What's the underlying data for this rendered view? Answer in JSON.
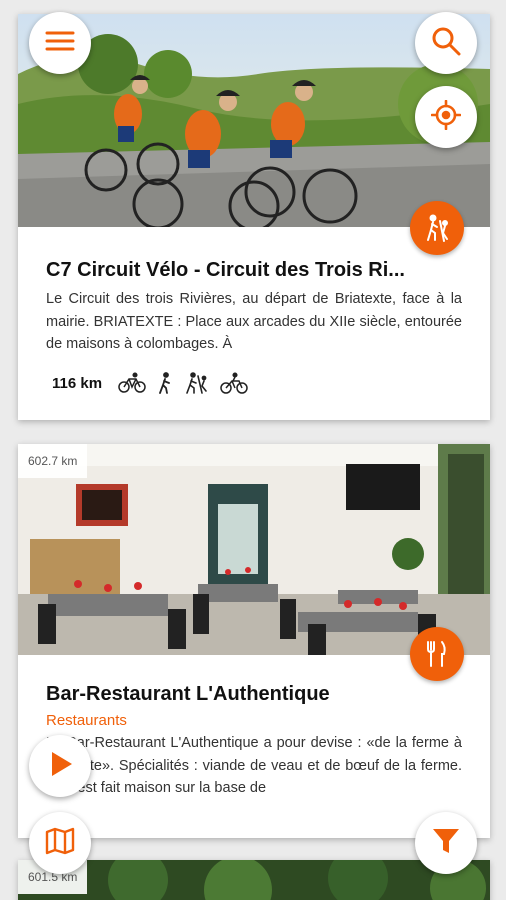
{
  "cards": [
    {
      "distance_tag": "",
      "title": "C7 Circuit Vélo - Circuit des Trois Ri...",
      "category": "",
      "description": "Le Circuit des trois Rivières, au départ de Briatexte, face à la mairie. BRIATEXTE : Place aux arcades du XIIe siècle, entourée de maisons à colombages. À",
      "distance_km": "116 km",
      "badge_icon": "hiking-icon",
      "activity_icons": [
        "bicycle-icon",
        "walking-icon",
        "hiking-icon",
        "cycling-icon"
      ]
    },
    {
      "distance_tag": "602.7 km",
      "title": "Bar-Restaurant L'Authentique",
      "category": "Restaurants",
      "description": "Le Bar-Restaurant L'Authentique a pour devise : «de la ferme à l'assiette». Spécialités : viande de veau et de bœuf de la ferme. Tout est fait maison sur la base de",
      "badge_icon": "fork-knife-icon"
    },
    {
      "distance_tag": "601.5 km"
    }
  ],
  "colors": {
    "accent": "#f0600a",
    "card_bg": "#ffffff",
    "page_bg": "#ebebeb"
  },
  "fabs": [
    "menu-icon",
    "search-icon",
    "locate-icon",
    "play-icon",
    "map-icon",
    "filter-icon"
  ]
}
